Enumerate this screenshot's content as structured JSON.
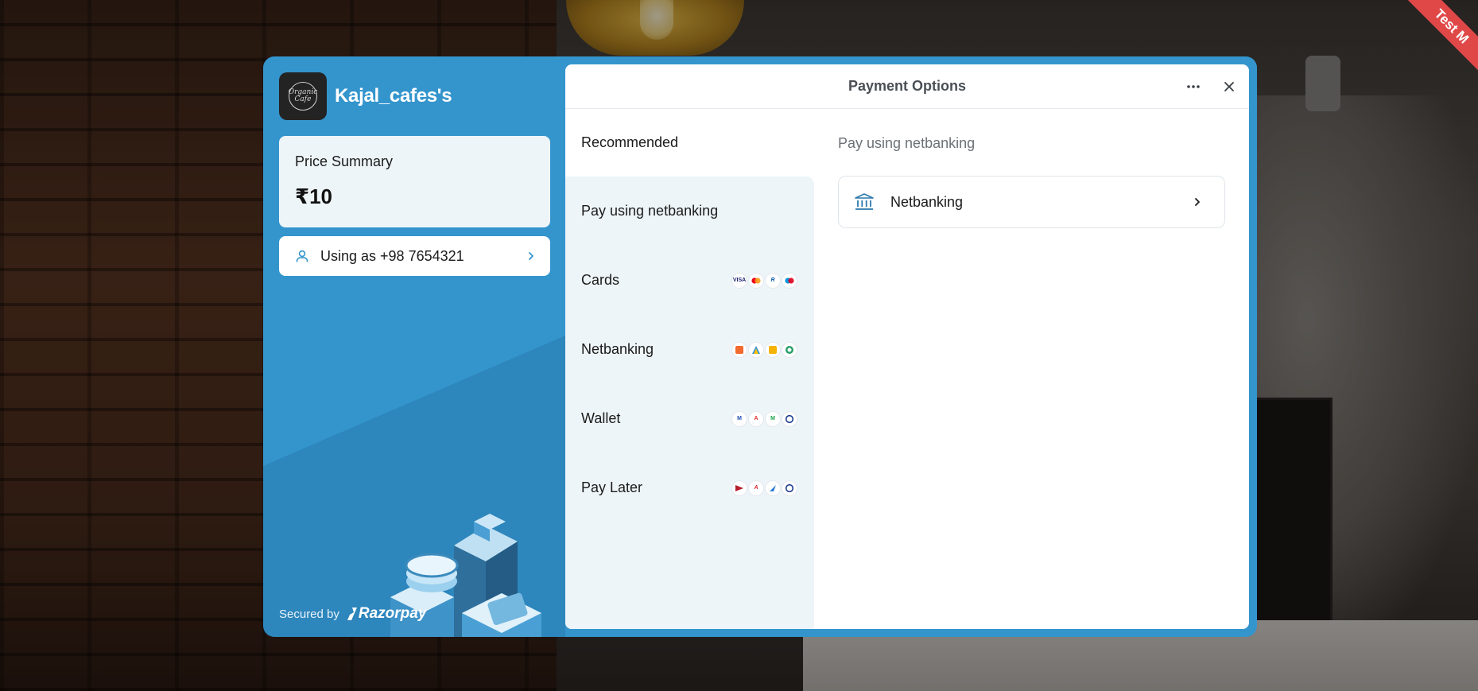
{
  "merchant": {
    "name": "Kajal_cafes's",
    "logo_text": "Organic Cafe"
  },
  "price_summary": {
    "title": "Price Summary",
    "amount": "₹10"
  },
  "user": {
    "label": "Using as +98 7654321"
  },
  "footer": {
    "secured_by": "Secured by",
    "brand": "Razorpay"
  },
  "ribbon": "Test M",
  "panel": {
    "title": "Payment Options",
    "recommended": "Recommended",
    "methods": [
      {
        "label": "Pay using netbanking",
        "badges": []
      },
      {
        "label": "Cards",
        "badges": [
          "VISA",
          "MC",
          "RuPay",
          "Maestro"
        ]
      },
      {
        "label": "Netbanking",
        "badges": [
          "bank-1",
          "bank-2",
          "bank-3",
          "bank-4"
        ]
      },
      {
        "label": "Wallet",
        "badges": [
          "wallet-1",
          "wallet-2",
          "wallet-3",
          "wallet-4"
        ]
      },
      {
        "label": "Pay Later",
        "badges": [
          "paylater-1",
          "paylater-2",
          "paylater-3",
          "paylater-4"
        ]
      }
    ],
    "detail_title": "Pay using netbanking",
    "option_label": "Netbanking"
  },
  "colors": {
    "brand_blue": "#3495cd",
    "panel_bg": "#eef5f8"
  }
}
